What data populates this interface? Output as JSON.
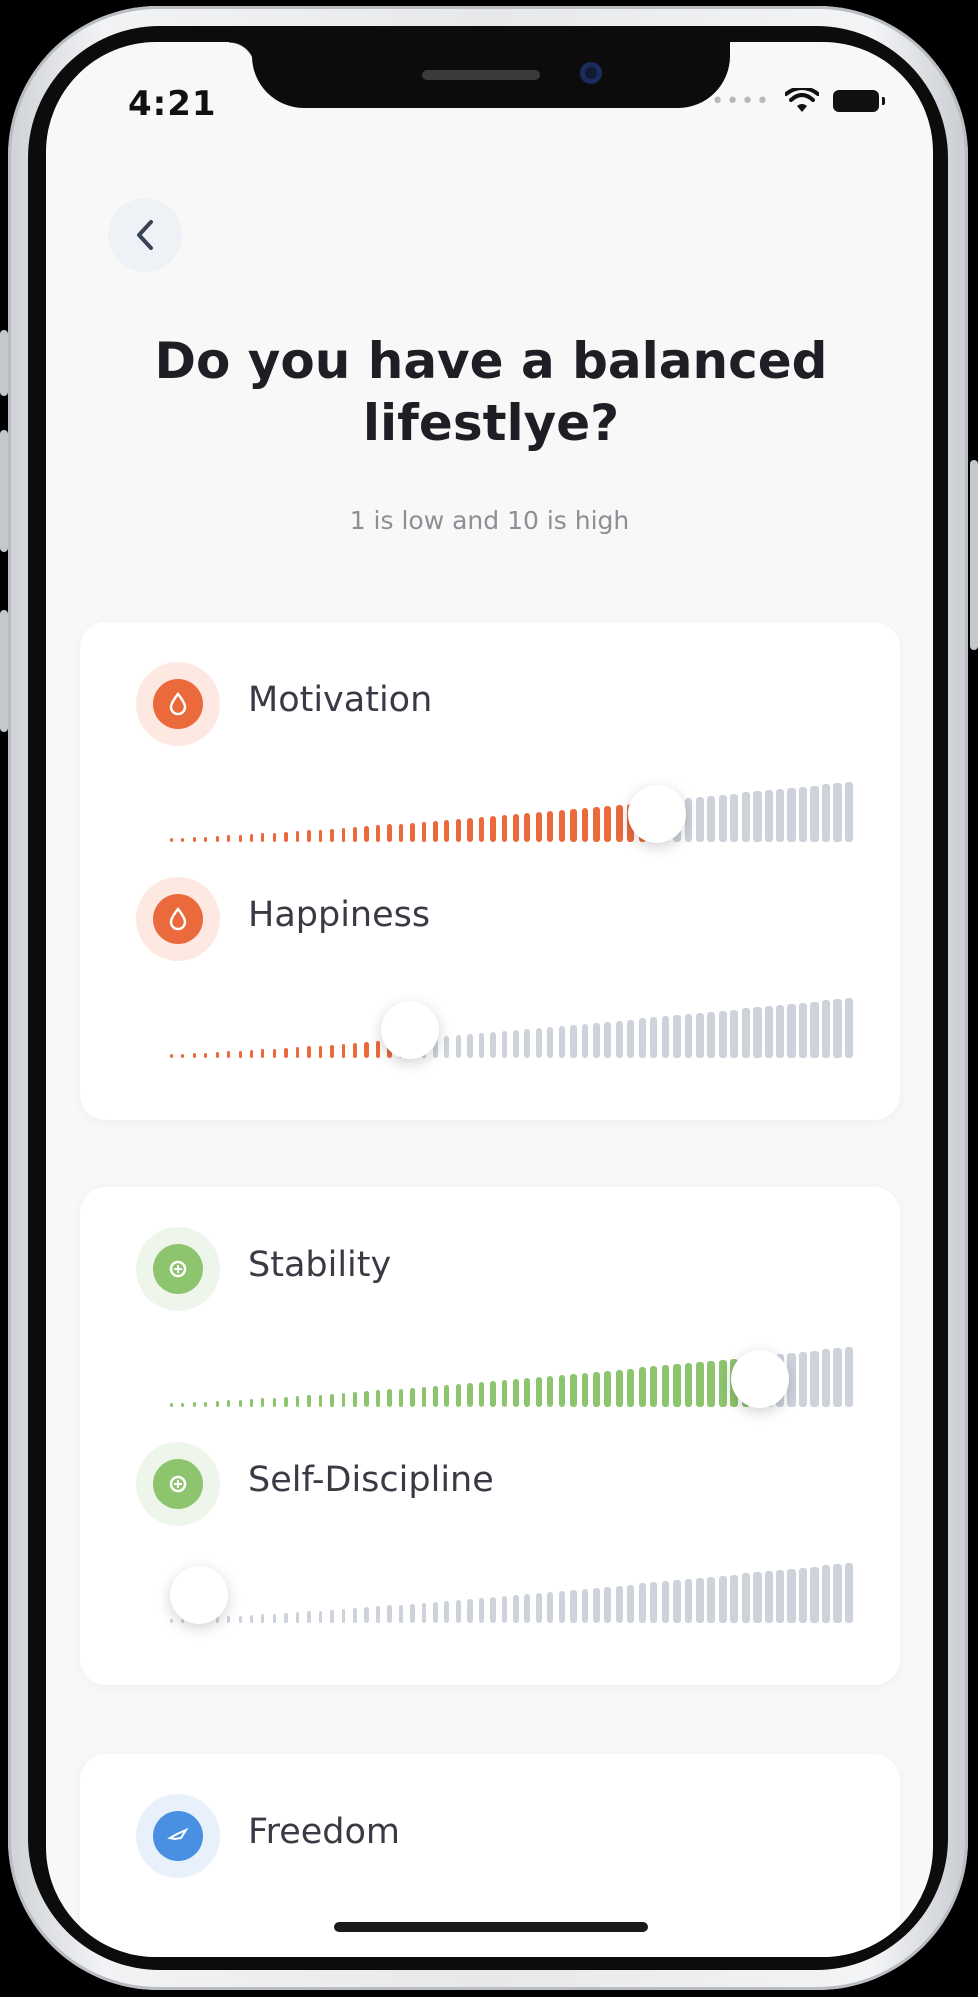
{
  "status": {
    "time": "4:21",
    "signal_dots": "••••"
  },
  "header": {
    "title": "Do you have a balanced lifestlye?",
    "subtitle": "1 is low and 10 is high"
  },
  "colors": {
    "orange": "#ea6a3b",
    "orange_soft": "#fde9e2",
    "green": "#8dc46e",
    "green_soft": "#eef5ea",
    "blue": "#4a90e2",
    "blue_soft": "#e7f0fb",
    "track": "#cdd2db"
  },
  "cards": [
    {
      "rows": [
        {
          "label": "Motivation",
          "value": 0.71,
          "color": "orange"
        },
        {
          "label": "Happiness",
          "value": 0.35,
          "color": "orange"
        }
      ]
    },
    {
      "rows": [
        {
          "label": "Stability",
          "value": 0.86,
          "color": "green"
        },
        {
          "label": "Self-Discipline",
          "value": 0.0,
          "color": "green"
        }
      ]
    },
    {
      "rows": [
        {
          "label": "Freedom",
          "value": null,
          "color": "blue"
        }
      ]
    }
  ]
}
